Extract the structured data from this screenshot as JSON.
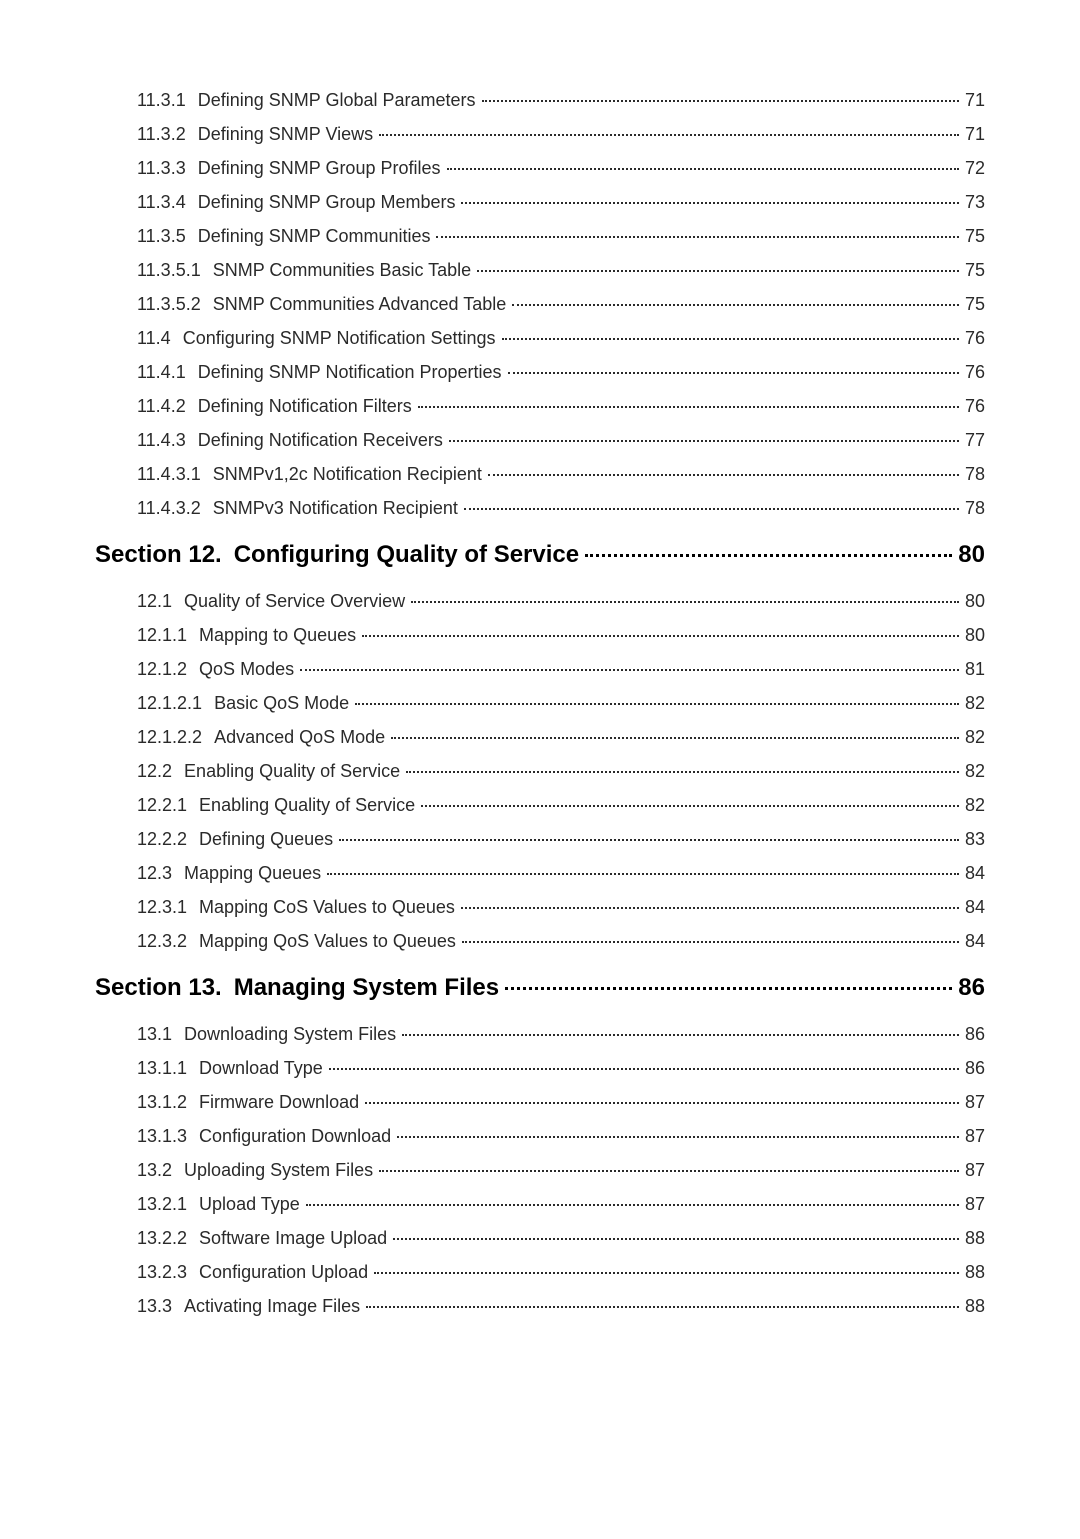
{
  "toc": [
    {
      "level": 1,
      "number": "11.3.1",
      "title": "Defining SNMP Global Parameters",
      "page": "71"
    },
    {
      "level": 1,
      "number": "11.3.2",
      "title": "Defining SNMP Views",
      "page": "71"
    },
    {
      "level": 1,
      "number": "11.3.3",
      "title": "Defining SNMP Group Profiles",
      "page": "72"
    },
    {
      "level": 1,
      "number": "11.3.4",
      "title": "Defining SNMP Group Members",
      "page": "73"
    },
    {
      "level": 1,
      "number": "11.3.5",
      "title": "Defining SNMP Communities",
      "page": "75"
    },
    {
      "level": 1,
      "number": "11.3.5.1",
      "title": "SNMP Communities Basic Table",
      "page": "75"
    },
    {
      "level": 1,
      "number": "11.3.5.2",
      "title": "SNMP Communities Advanced Table",
      "page": "75"
    },
    {
      "level": 1,
      "number": "11.4",
      "title": "Configuring SNMP Notification Settings",
      "page": "76"
    },
    {
      "level": 1,
      "number": "11.4.1",
      "title": "Defining SNMP Notification Properties",
      "page": "76"
    },
    {
      "level": 1,
      "number": "11.4.2",
      "title": "Defining Notification Filters",
      "page": "76"
    },
    {
      "level": 1,
      "number": "11.4.3",
      "title": "Defining Notification Receivers",
      "page": "77"
    },
    {
      "level": 1,
      "number": "11.4.3.1",
      "title": "SNMPv1,2c Notification Recipient",
      "page": "78"
    },
    {
      "level": 1,
      "number": "11.4.3.2",
      "title": "SNMPv3 Notification Recipient",
      "page": "78"
    },
    {
      "level": 0,
      "number": "Section 12.",
      "title": "Configuring Quality of Service",
      "page": "80"
    },
    {
      "level": 1,
      "number": "12.1",
      "title": "Quality of Service Overview",
      "page": "80"
    },
    {
      "level": 1,
      "number": "12.1.1",
      "title": "Mapping to Queues",
      "page": "80"
    },
    {
      "level": 1,
      "number": "12.1.2",
      "title": "QoS Modes",
      "page": "81"
    },
    {
      "level": 1,
      "number": "12.1.2.1",
      "title": "Basic QoS Mode",
      "page": "82"
    },
    {
      "level": 1,
      "number": "12.1.2.2",
      "title": "Advanced QoS Mode",
      "page": "82"
    },
    {
      "level": 1,
      "number": "12.2",
      "title": "Enabling Quality of Service",
      "page": "82"
    },
    {
      "level": 1,
      "number": "12.2.1",
      "title": "Enabling Quality of Service",
      "page": "82"
    },
    {
      "level": 1,
      "number": "12.2.2",
      "title": "Defining Queues",
      "page": "83"
    },
    {
      "level": 1,
      "number": "12.3",
      "title": "Mapping Queues",
      "page": "84"
    },
    {
      "level": 1,
      "number": "12.3.1",
      "title": "Mapping CoS Values to Queues",
      "page": "84"
    },
    {
      "level": 1,
      "number": "12.3.2",
      "title": "Mapping QoS Values to Queues",
      "page": "84"
    },
    {
      "level": 0,
      "number": "Section 13.",
      "title": "Managing System Files",
      "page": "86"
    },
    {
      "level": 1,
      "number": "13.1",
      "title": "Downloading System Files",
      "page": "86"
    },
    {
      "level": 1,
      "number": "13.1.1",
      "title": "Download Type",
      "page": "86"
    },
    {
      "level": 1,
      "number": "13.1.2",
      "title": "Firmware Download",
      "page": "87"
    },
    {
      "level": 1,
      "number": "13.1.3",
      "title": "Configuration Download",
      "page": "87"
    },
    {
      "level": 1,
      "number": "13.2",
      "title": "Uploading System Files",
      "page": "87"
    },
    {
      "level": 1,
      "number": "13.2.1",
      "title": "Upload Type",
      "page": "87"
    },
    {
      "level": 1,
      "number": "13.2.2",
      "title": "Software Image Upload",
      "page": "88"
    },
    {
      "level": 1,
      "number": "13.2.3",
      "title": "Configuration Upload",
      "page": "88"
    },
    {
      "level": 1,
      "number": "13.3",
      "title": "Activating Image Files",
      "page": "88"
    }
  ]
}
